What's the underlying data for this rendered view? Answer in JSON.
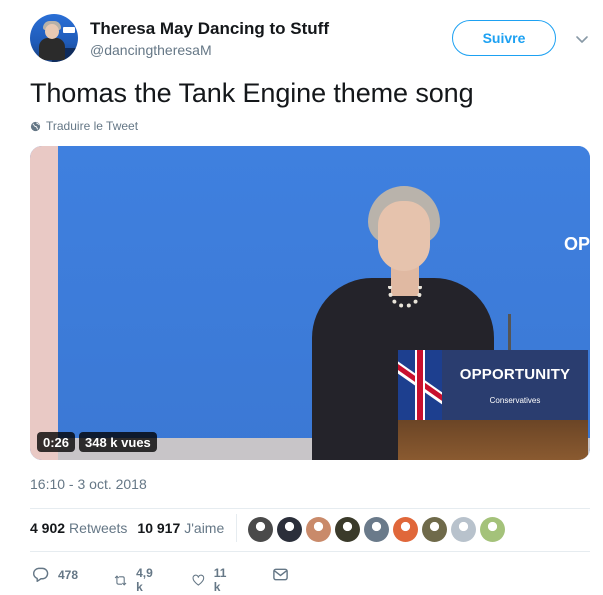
{
  "author": {
    "name": "Theresa May Dancing to Stuff",
    "handle": "@dancingtheresaM",
    "follow_label": "Suivre"
  },
  "tweet": {
    "text": "Thomas the Tank Engine theme song",
    "translate_label": "Traduire le Tweet",
    "timestamp": "16:10 - 3 oct. 2018"
  },
  "video": {
    "duration": "0:26",
    "views": "348 k vues",
    "background_text": "OP",
    "podium_label": "OPPORTUNITY",
    "podium_sub": "Conservatives"
  },
  "stats": {
    "retweets_count": "4 902",
    "retweets_label": "Retweets",
    "likes_count": "10 917",
    "likes_label": "J'aime"
  },
  "liker_avatars": [
    "#4a4a4a",
    "#2b2f3a",
    "#c98a6a",
    "#3a3a2a",
    "#6a7a8a",
    "#e0673a",
    "#6f6a4a",
    "#b8c2cc",
    "#a4c27a"
  ],
  "actions": {
    "reply_count": "478",
    "retweet_count": "4,9 k",
    "like_count": "11 k"
  },
  "colors": {
    "accent": "#1da1f2",
    "muted": "#657786",
    "text": "#14171a",
    "divider": "#e6ecf0"
  },
  "icons": [
    "globe-icon",
    "chevron-down-icon",
    "reply-icon",
    "retweet-icon",
    "like-icon",
    "direct-message-icon"
  ]
}
